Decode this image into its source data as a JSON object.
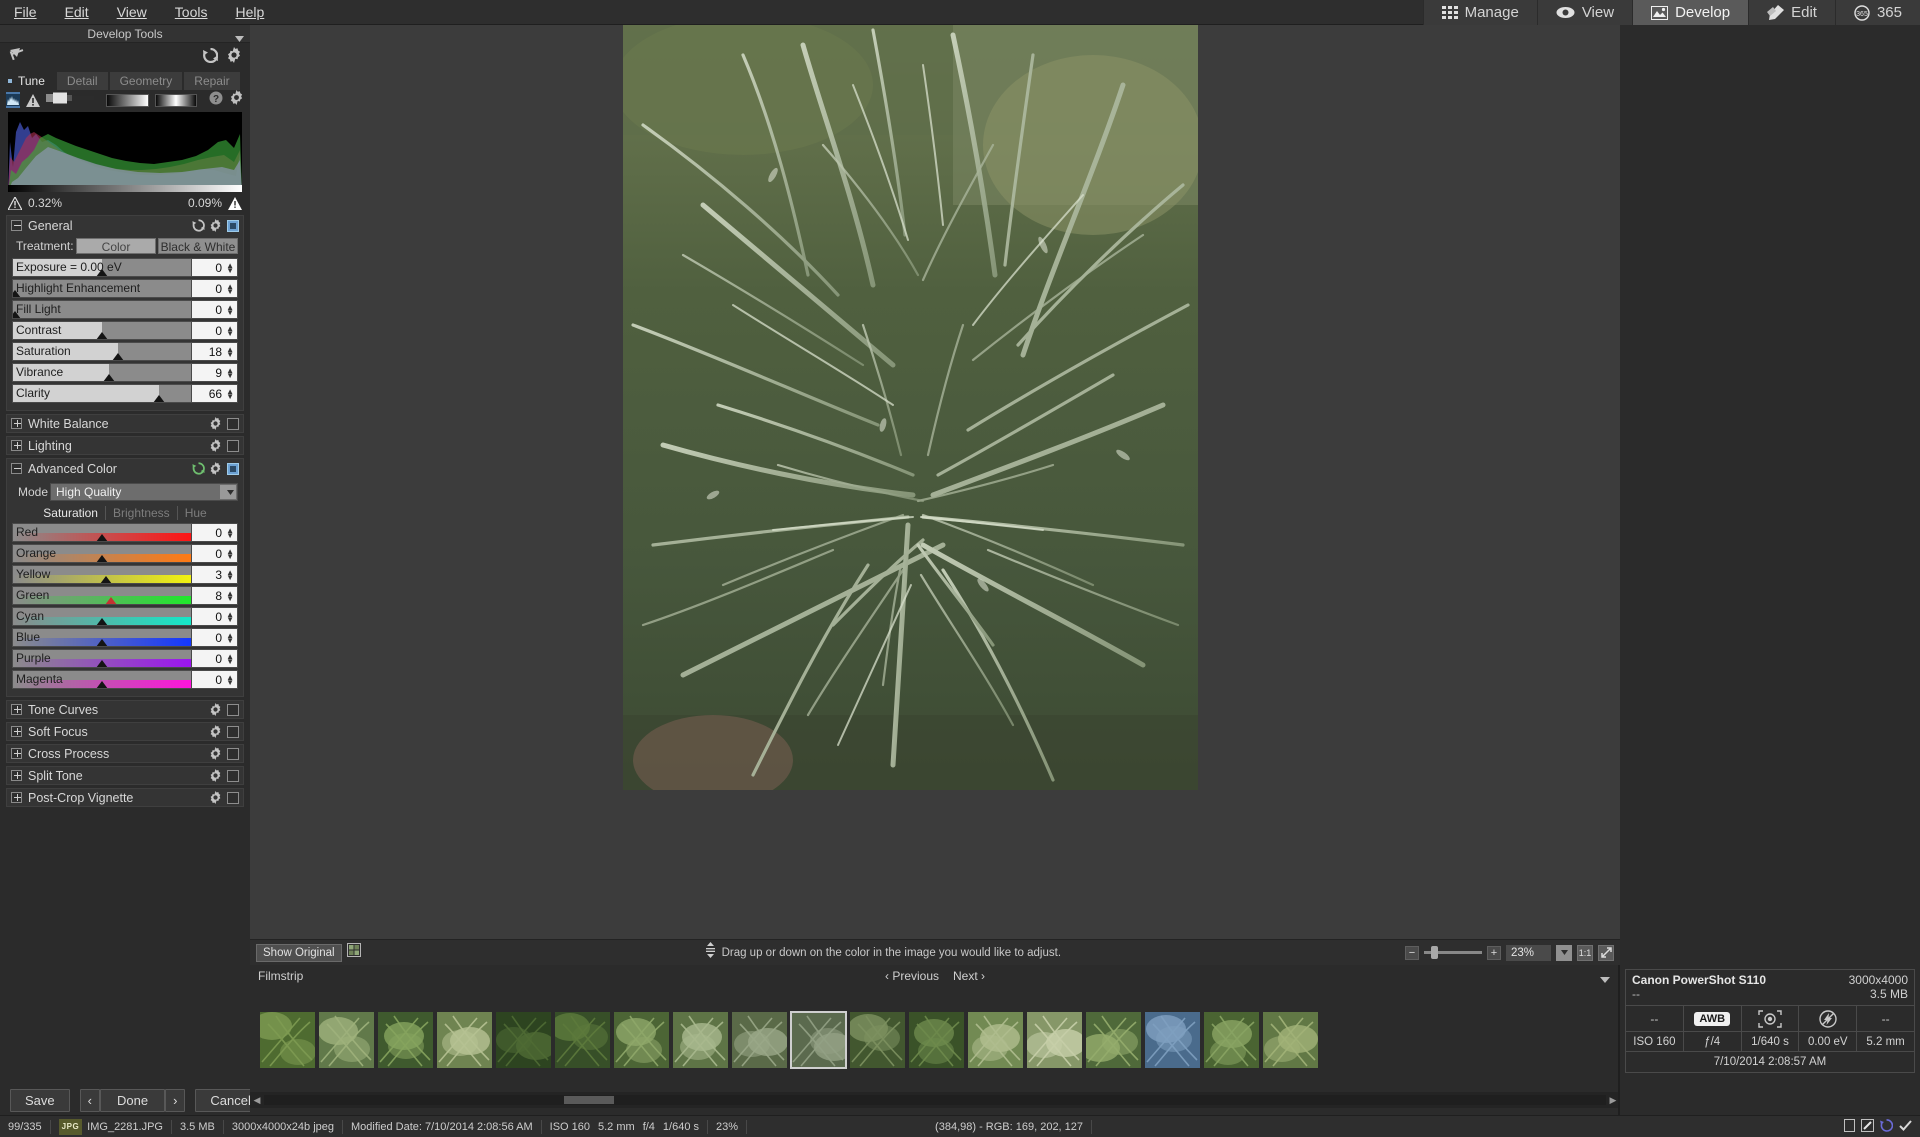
{
  "menubar": {
    "items": [
      "File",
      "Edit",
      "View",
      "Tools",
      "Help"
    ],
    "modes": [
      {
        "label": "Manage",
        "icon": "grid-icon",
        "active": false
      },
      {
        "label": "View",
        "icon": "eye-icon",
        "active": false
      },
      {
        "label": "Develop",
        "icon": "picture-icon",
        "active": true
      },
      {
        "label": "Edit",
        "icon": "brush-icon",
        "active": false
      },
      {
        "label": "365",
        "icon": "365-icon",
        "active": false
      }
    ]
  },
  "left_panel": {
    "title": "Develop Tools",
    "tabs": [
      {
        "label": "Tune",
        "active": true
      },
      {
        "label": "Detail",
        "active": false
      },
      {
        "label": "Geometry",
        "active": false
      },
      {
        "label": "Repair",
        "active": false
      }
    ],
    "histogram": {
      "clip_shadow": "0.32%",
      "clip_highlight": "0.09%"
    },
    "general": {
      "title": "General",
      "treatment_label": "Treatment:",
      "treatment_options": [
        "Color",
        "Black & White"
      ],
      "treatment_selected": "Color",
      "sliders": [
        {
          "label": "Exposure = 0.00 eV",
          "value": "0",
          "pos": 50,
          "fill": 50
        },
        {
          "label": "Highlight Enhancement",
          "value": "0",
          "pos": 1,
          "fill": 0
        },
        {
          "label": "Fill Light",
          "value": "0",
          "pos": 1,
          "fill": 0
        },
        {
          "label": "Contrast",
          "value": "0",
          "pos": 50,
          "fill": 50
        },
        {
          "label": "Saturation",
          "value": "18",
          "pos": 59,
          "fill": 59
        },
        {
          "label": "Vibrance",
          "value": "9",
          "pos": 54,
          "fill": 54
        },
        {
          "label": "Clarity",
          "value": "66",
          "pos": 82,
          "fill": 82
        }
      ]
    },
    "white_balance": {
      "title": "White Balance"
    },
    "lighting": {
      "title": "Lighting"
    },
    "advanced_color": {
      "title": "Advanced Color",
      "mode_label": "Mode",
      "mode_value": "High Quality",
      "subtabs": [
        {
          "label": "Saturation",
          "active": true
        },
        {
          "label": "Brightness",
          "active": false
        },
        {
          "label": "Hue",
          "active": false
        }
      ],
      "sliders": [
        {
          "label": "Red",
          "value": "0",
          "pos": 50,
          "color": "#ff1414",
          "thumb": "dark"
        },
        {
          "label": "Orange",
          "value": "0",
          "pos": 50,
          "color": "#ff7a14",
          "thumb": "dark"
        },
        {
          "label": "Yellow",
          "value": "3",
          "pos": 52,
          "color": "#f2f20f",
          "thumb": "dark"
        },
        {
          "label": "Green",
          "value": "8",
          "pos": 55,
          "color": "#1fe82b",
          "thumb": "red"
        },
        {
          "label": "Cyan",
          "value": "0",
          "pos": 50,
          "color": "#14e8c8",
          "thumb": "dark"
        },
        {
          "label": "Blue",
          "value": "0",
          "pos": 50,
          "color": "#1437ff",
          "thumb": "dark"
        },
        {
          "label": "Purple",
          "value": "0",
          "pos": 50,
          "color": "#9b14f0",
          "thumb": "dark"
        },
        {
          "label": "Magenta",
          "value": "0",
          "pos": 50,
          "color": "#ff14dc",
          "thumb": "dark"
        }
      ]
    },
    "more_sections": [
      {
        "title": "Tone Curves"
      },
      {
        "title": "Soft Focus"
      },
      {
        "title": "Cross Process"
      },
      {
        "title": "Split Tone"
      },
      {
        "title": "Post-Crop Vignette"
      }
    ],
    "buttons": {
      "save": "Save",
      "prev": "‹",
      "done": "Done",
      "next": "›",
      "cancel": "Cancel"
    }
  },
  "canvas": {
    "show_original": "Show Original",
    "hint": "Drag up or down on the color in the image you would like to adjust.",
    "zoom_value": "23%",
    "zoom_one_to_one": "1:1",
    "zoom_minus": "−",
    "zoom_plus": "+"
  },
  "filmstrip": {
    "title": "Filmstrip",
    "previous": "Previous",
    "next": "Next",
    "selected_index": 9,
    "thumb_count": 18
  },
  "metadata": {
    "camera": "Canon PowerShot S110",
    "dimensions": "3000x4000",
    "lens": "--",
    "filesize": "3.5 MB",
    "icon_row": [
      "--",
      "AWB",
      "metering-icon",
      "flash-off-icon",
      "--"
    ],
    "exif": [
      "ISO 160",
      "ƒ/4",
      "1/640 s",
      "0.00 eV",
      "5.2 mm"
    ],
    "date": "7/10/2014 2:08:57 AM"
  },
  "status_bar": {
    "counter": "99/335",
    "format_tag": "JPG",
    "filename": "IMG_2281.JPG",
    "filesize": "3.5 MB",
    "dimensions": "3000x4000x24b jpeg",
    "modified": "Modified Date: 7/10/2014 2:08:56 AM",
    "iso": "ISO 160",
    "focal": "5.2 mm",
    "aperture": "f/4",
    "shutter": "1/640 s",
    "zoom": "23%",
    "pixel_info": "(384,98) - RGB: 169, 202, 127"
  },
  "colors": {
    "accent": "#6da2d4",
    "panel_bg": "#2b2b2b",
    "canvas_bg": "#3c3c3c",
    "active_tab": "#5a5a5a"
  }
}
